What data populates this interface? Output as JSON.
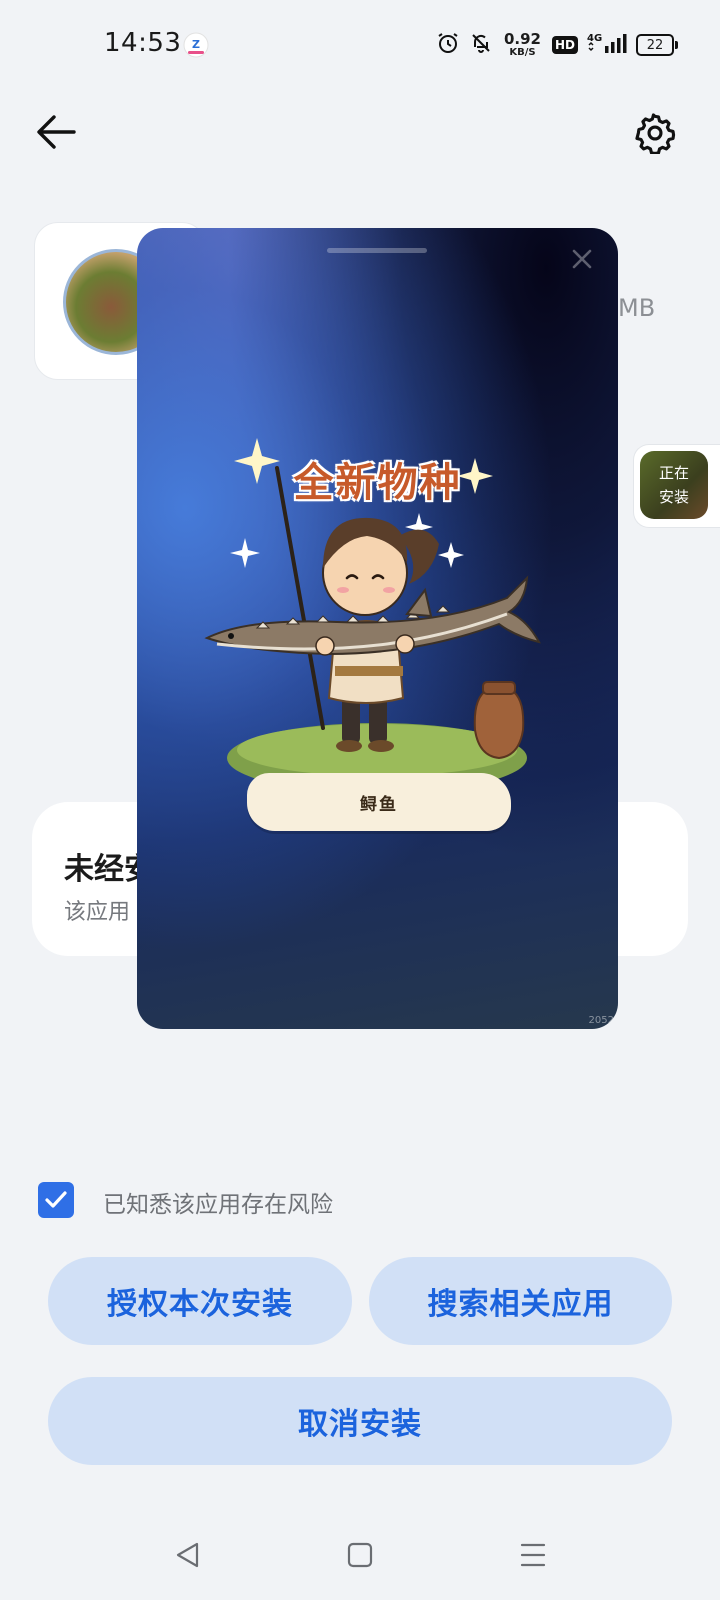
{
  "status_bar": {
    "time": "14:53",
    "net_speed_value": "0.92",
    "net_speed_unit": "KB/S",
    "hd_label": "HD",
    "network_type": "4G",
    "battery_level": "22"
  },
  "header": {
    "back_icon": "arrow-left-icon",
    "settings_icon": "gear-icon"
  },
  "background": {
    "size_fragment": "MB",
    "installing_badge": {
      "line1": "正在",
      "line2": "安装"
    },
    "warning_title_fragment": "未经安",
    "warning_desc_fragment": "该应用"
  },
  "ad_popup": {
    "headline": "全新物种",
    "caption": "鲟鱼",
    "ad_id": "2052",
    "close_icon": "close-icon"
  },
  "risk_acknowledge": {
    "checked": true,
    "label": "已知悉该应用存在风险"
  },
  "buttons": {
    "authorize": "授权本次安装",
    "search_related": "搜索相关应用",
    "cancel": "取消安装"
  },
  "colors": {
    "accent": "#1b63dd",
    "button_bg": "#d1e0f6",
    "checkbox": "#2f6fe6",
    "page_bg": "#f1f3f6"
  }
}
